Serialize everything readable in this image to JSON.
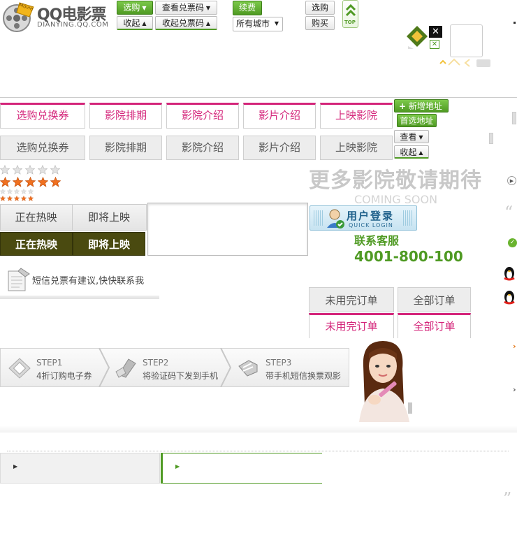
{
  "brand": {
    "name": "QQ电影票",
    "domain": "DIANYING.QQ.COM",
    "badge": "Movie"
  },
  "topbar": {
    "select_label": "选购",
    "collapse_label": "收起",
    "view_codes_label": "查看兑票码",
    "collapse_codes_label": "收起兑票码",
    "renew_label": "续费",
    "city_label": "所有城市",
    "select2_label": "选购",
    "buy_label": "购买",
    "top_label": "TOP"
  },
  "tabs_primary": [
    "选购兑换券",
    "影院排期",
    "影院介绍",
    "影片介绍",
    "上映影院"
  ],
  "tabs_secondary": [
    "选购兑换券",
    "影院排期",
    "影院介绍",
    "影片介绍",
    "上映影院"
  ],
  "address": {
    "add_label": "新增地址",
    "preferred_label": "首选地址",
    "view_label": "查看",
    "collapse_label": "收起"
  },
  "ratings": {
    "large": 5,
    "medium": 5,
    "small": 5,
    "tiny": 5
  },
  "promo": {
    "headline": "更多影院敬请期待",
    "subline": "COMING SOON"
  },
  "movie_tabs": {
    "now_showing": "正在热映",
    "coming_soon": "即将上映"
  },
  "login": {
    "label": "用户登录",
    "sublabel": "QUICK LOGIN"
  },
  "service": {
    "label": "联系客服",
    "phone": "4001-800-100"
  },
  "feedback": {
    "label": "短信兑票有建议,快快联系我"
  },
  "orders": {
    "unused": "未用完订单",
    "all": "全部订单"
  },
  "steps": [
    {
      "title": "STEP1",
      "desc": "4折订购电子券"
    },
    {
      "title": "STEP2",
      "desc": "将验证码下发到手机"
    },
    {
      "title": "STEP3",
      "desc": "带手机短信换票观影"
    }
  ],
  "colors": {
    "accent_pink": "#d4257a",
    "accent_green": "#4f9a23",
    "dark_olive": "#4a4a10",
    "star_orange": "#f07020"
  }
}
